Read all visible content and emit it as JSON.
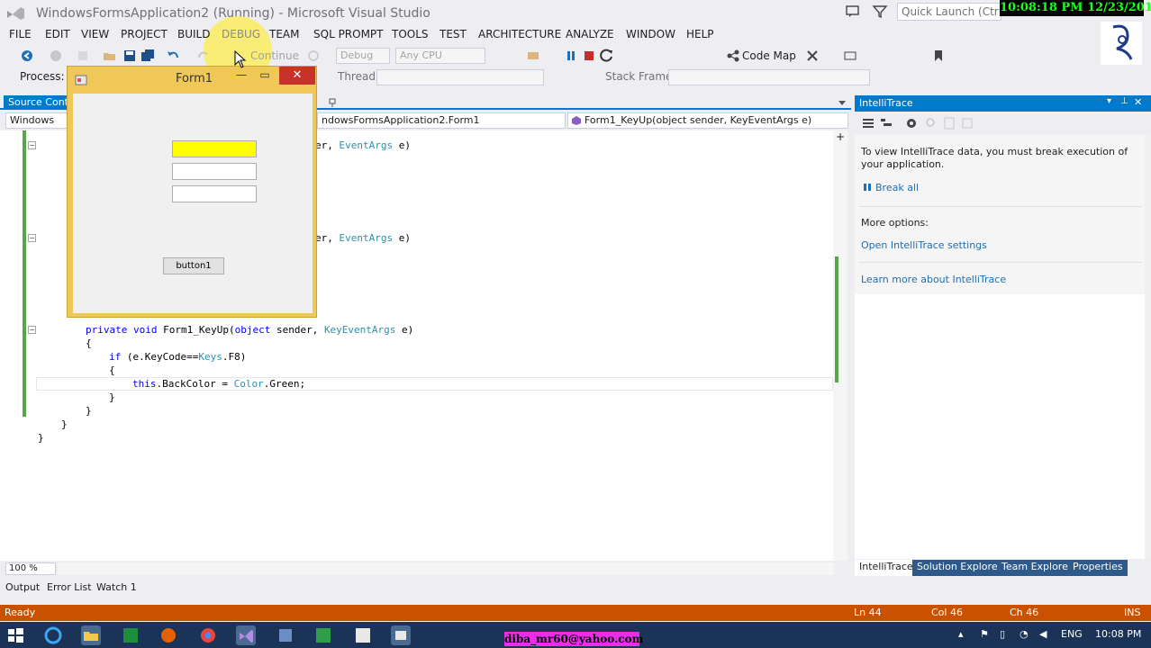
{
  "window": {
    "title": "WindowsFormsApplication2 (Running) - Microsoft Visual Studio",
    "quick_launch_placeholder": "Quick Launch (Ctrl+Q)"
  },
  "overlay": {
    "clock": "10:08:18 PM 12/23/2016",
    "email": "diba_mr60@yahoo.com"
  },
  "menu": [
    "FILE",
    "EDIT",
    "VIEW",
    "PROJECT",
    "BUILD",
    "DEBUG",
    "TEAM",
    "SQL PROMPT",
    "TOOLS",
    "TEST",
    "ARCHITECTURE",
    "ANALYZE",
    "WINDOW",
    "HELP"
  ],
  "toolbar": {
    "continue": "Continue",
    "config": "Debug",
    "platform": "Any CPU",
    "code_map": "Code Map",
    "process_label": "Process:",
    "thread_label": "Thread:",
    "stack_frame_label": "Stack Frame:"
  },
  "editor": {
    "source_control_tab": "Source Contr",
    "nav_left": "Windows",
    "nav_middle": "ndowsFormsApplication2.Form1",
    "nav_right": "Form1_KeyUp(object sender, KeyEventArgs e)",
    "zoom": "100 %",
    "code": {
      "frag1_a": "er, ",
      "frag1_b": "EventArgs",
      "frag1_c": " e)",
      "frag2_a": "er, ",
      "frag2_b": "EventArgs",
      "frag2_c": " e)",
      "l1_kw": "private void",
      "l1_rest": " Form1_KeyUp(",
      "l1_kw2": "object",
      "l1_mid": " sender, ",
      "l1_ty": "KeyEventArgs",
      "l1_end": " e)",
      "l2": "{",
      "l3_kw": "if",
      "l3_a": " (e.KeyCode==",
      "l3_ty": "Keys",
      "l3_b": ".F8)",
      "l4": "{",
      "l5_kw": "this",
      "l5_a": ".BackColor = ",
      "l5_ty": "Color",
      "l5_b": ".Green;",
      "l6": "}",
      "l7": "}",
      "l8": "}",
      "l9": "}"
    }
  },
  "form1": {
    "title": "Form1",
    "button": "button1"
  },
  "intellitrace": {
    "title": "IntelliTrace",
    "message": "To view IntelliTrace data, you must break execution of your application.",
    "break_all": "Break all",
    "more_options": "More options:",
    "open_settings": "Open IntelliTrace settings",
    "learn_more": "Learn more about IntelliTrace"
  },
  "right_tabs": [
    "IntelliTrace",
    "Solution Explorer",
    "Team Explorer",
    "Properties"
  ],
  "bottom_tabs": [
    "Output",
    "Error List",
    "Watch 1"
  ],
  "status": {
    "ready": "Ready",
    "ln": "Ln 44",
    "col": "Col 46",
    "ch": "Ch 46",
    "ins": "INS"
  },
  "taskbar": {
    "lang": "ENG",
    "time": "10:08 PM"
  },
  "colors": {
    "accent": "#007ACC",
    "status_bar": "#CA5100",
    "form_title": "#F0C857",
    "textbox_focus": "#FFFF00"
  }
}
